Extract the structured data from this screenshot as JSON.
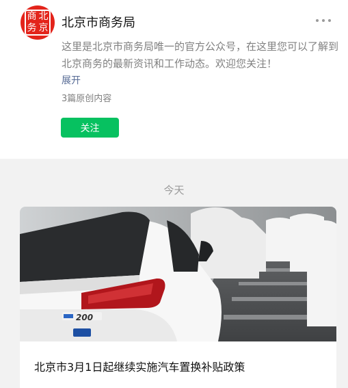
{
  "account": {
    "avatar_chars": [
      "北",
      "京",
      "商",
      "务"
    ],
    "name": "北京市商务局",
    "description": "这里是北京市商务局唯一的官方公众号，在这里您可以了解到北京商务的最新资讯和工作动态。欢迎您关注！",
    "expand_label": "展开",
    "original_count": "3篇原创内容",
    "follow_label": "关注"
  },
  "feed": {
    "date_label": "今天",
    "articles": [
      {
        "title": "北京市3月1日起继续实施汽车置换补贴政策",
        "badge_text": "200"
      }
    ]
  },
  "colors": {
    "brand_red": "#e3241b",
    "follow_green": "#07c160",
    "link_blue": "#576b95"
  }
}
